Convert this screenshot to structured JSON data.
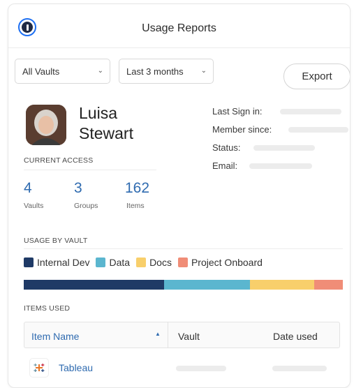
{
  "header": {
    "title": "Usage Reports",
    "logo_icon": "onepassword-logo-icon"
  },
  "filters": {
    "vault": {
      "selected": "All Vaults"
    },
    "period": {
      "selected": "Last 3 months"
    },
    "export_label": "Export"
  },
  "user": {
    "first_name": "Luisa",
    "last_name": "Stewart",
    "fields": [
      {
        "label": "Last Sign in:"
      },
      {
        "label": "Member since:"
      },
      {
        "label": "Status:"
      },
      {
        "label": "Email:"
      }
    ]
  },
  "current_access": {
    "heading": "CURRENT ACCESS",
    "stats": [
      {
        "value": "4",
        "label": "Vaults"
      },
      {
        "value": "3",
        "label": "Groups"
      },
      {
        "value": "162",
        "label": "Items"
      }
    ]
  },
  "usage_by_vault": {
    "heading": "USAGE BY VAULT",
    "legend": [
      {
        "label": "Internal Dev",
        "color": "#1f3a66"
      },
      {
        "label": "Data",
        "color": "#5bb6cf"
      },
      {
        "label": "Docs",
        "color": "#f8cf6b"
      },
      {
        "label": "Project Onboard",
        "color": "#f08d77"
      }
    ],
    "shares": [
      0.44,
      0.27,
      0.2,
      0.09
    ]
  },
  "items_used": {
    "heading": "ITEMS USED",
    "columns": {
      "item_name": "Item Name",
      "vault": "Vault",
      "date_used": "Date used"
    },
    "rows": [
      {
        "name": "Tableau",
        "icon": "tableau-icon"
      }
    ]
  }
}
